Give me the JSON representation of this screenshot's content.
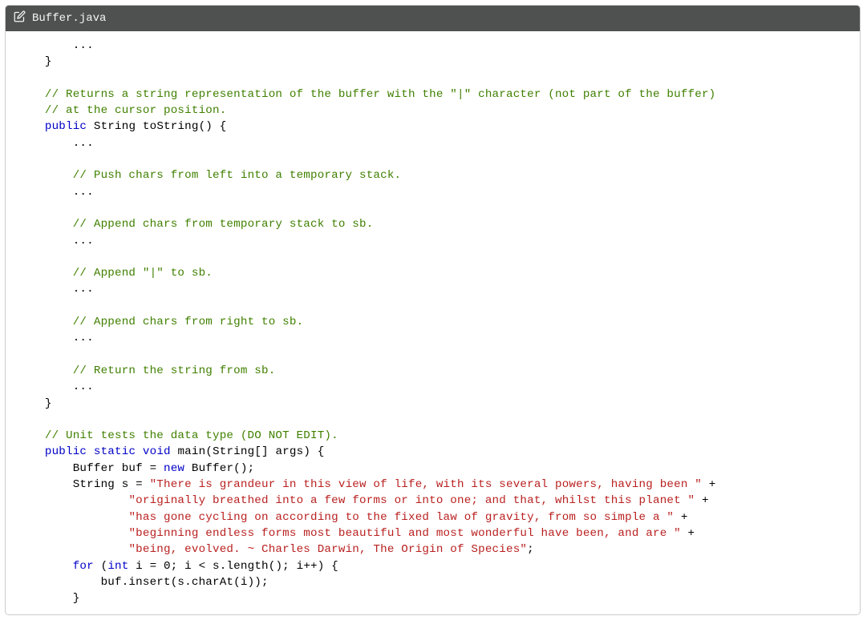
{
  "file": {
    "name": "Buffer.java"
  },
  "code": {
    "ellipsis": "...",
    "brace_close": "}",
    "comment_ret1": "// Returns a string representation of the buffer with the \"|\" character (not part of the buffer)",
    "comment_ret2": "// at the cursor position.",
    "kw_public": "public",
    "kw_static": "static",
    "kw_void": "void",
    "kw_new": "new",
    "kw_for": "for",
    "kw_int": "int",
    "type_string": "String",
    "sig_tostring_rest": " toString() {",
    "comment_push": "// Push chars from left into a temporary stack.",
    "comment_append_temp": "// Append chars from temporary stack to sb.",
    "comment_append_pipe": "// Append \"|\" to sb.",
    "comment_append_right": "// Append chars from right to sb.",
    "comment_return_sb": "// Return the string from sb.",
    "comment_unit": "// Unit tests the data type (DO NOT EDIT).",
    "sig_main_rest": " main(String[] args) {",
    "main_buf_decl_a": "Buffer buf = ",
    "main_buf_decl_b": " Buffer();",
    "main_s_decl": "String s = ",
    "str1": "\"There is grandeur in this view of life, with its several powers, having been \"",
    "str2": "\"originally breathed into a few forms or into one; and that, whilst this planet \"",
    "str3": "\"has gone cycling on according to the fixed law of gravity, from so simple a \"",
    "str4": "\"beginning endless forms most beautiful and most wonderful have been, and are \"",
    "str5": "\"being, evolved. ~ Charles Darwin, The Origin of Species\"",
    "plus": " +",
    "semicolon": ";",
    "for_open_a": " (",
    "for_open_b": " i = 0; i < s.length(); i++) {",
    "for_body": "buf.insert(s.charAt(i));"
  }
}
